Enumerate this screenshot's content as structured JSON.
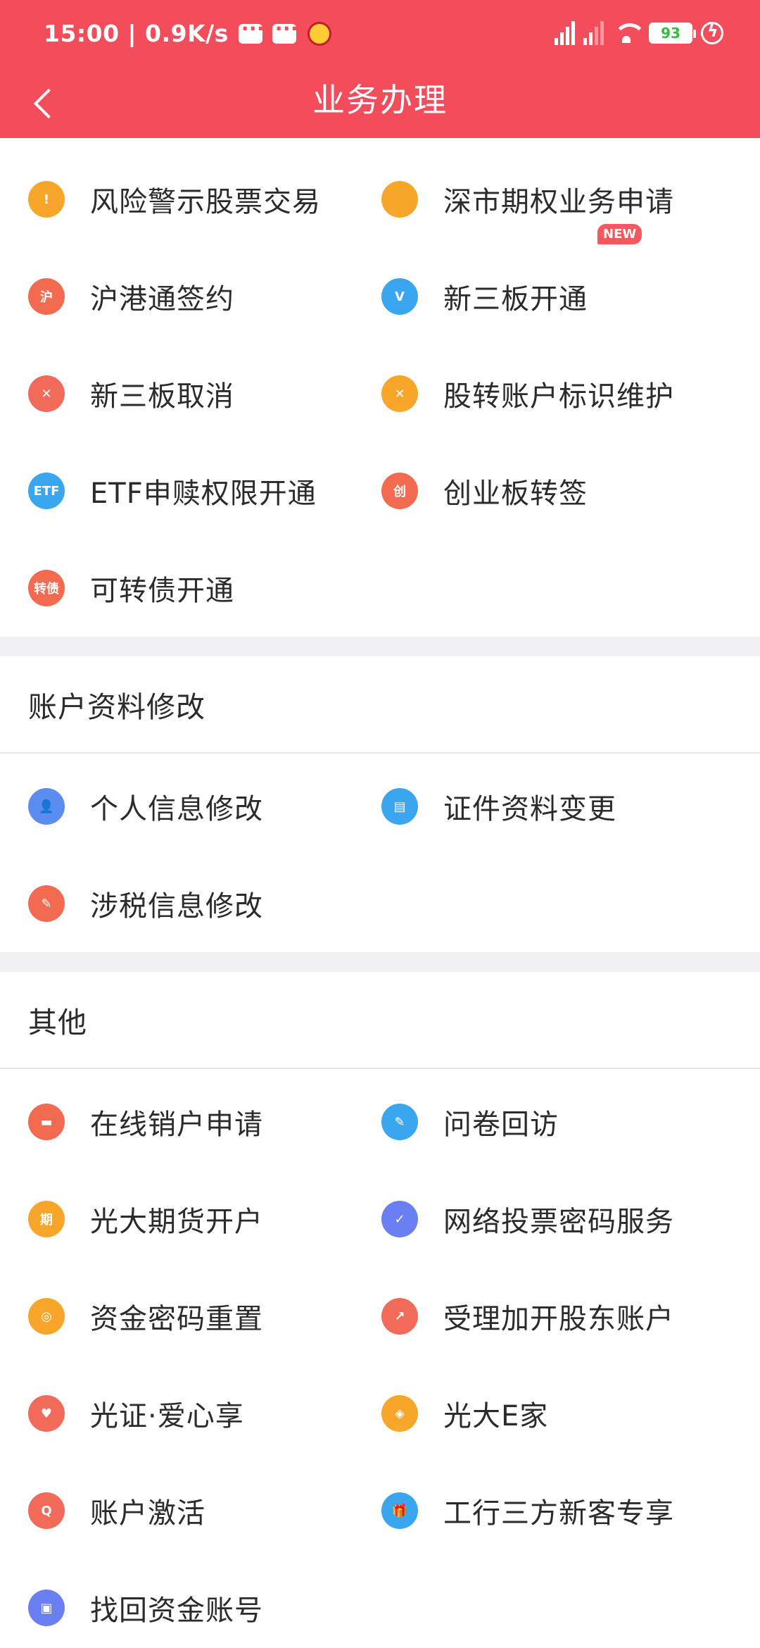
{
  "status_bar": {
    "time_speed": "15:00 | 0.9K/s",
    "battery": "93"
  },
  "header": {
    "title": "业务办理"
  },
  "colors": {
    "brand": "#f34c5a",
    "separator": "#f1f1f3"
  },
  "sections": [
    {
      "title": "",
      "items": [
        {
          "label": "风险警示股票交易",
          "icon": "shield-icon",
          "color": "#f7a52b",
          "glyph": "!"
        },
        {
          "label": "深市期权业务申请",
          "icon": "briefcase-icon",
          "color": "#f7a52b",
          "glyph": ""
        },
        {
          "label": "沪港通签约",
          "icon": "sign-icon",
          "color": "#f26a4f",
          "glyph": "沪"
        },
        {
          "label": "新三板开通",
          "icon": "v-icon",
          "color": "#3aa6f0",
          "glyph": "V",
          "badge": "NEW"
        },
        {
          "label": "新三板取消",
          "icon": "cancel-icon",
          "color": "#f26a5a",
          "glyph": "✕"
        },
        {
          "label": "股转账户标识维护",
          "icon": "tools-icon",
          "color": "#f7a52b",
          "glyph": "✕"
        },
        {
          "label": "ETF申赎权限开通",
          "icon": "etf-icon",
          "color": "#3aa6f0",
          "glyph": "ETF"
        },
        {
          "label": "创业板转签",
          "icon": "gem-card-icon",
          "color": "#f26a4f",
          "glyph": "创"
        },
        {
          "label": "可转债开通",
          "icon": "convertible-bond-icon",
          "color": "#f26a4f",
          "glyph": "转债"
        }
      ]
    },
    {
      "title": "账户资料修改",
      "items": [
        {
          "label": "个人信息修改",
          "icon": "user-edit-icon",
          "color": "#5b8df0",
          "glyph": "👤"
        },
        {
          "label": "证件资料变更",
          "icon": "id-card-icon",
          "color": "#3aa6f0",
          "glyph": "▤"
        },
        {
          "label": "涉税信息修改",
          "icon": "pencil-icon",
          "color": "#f26a4f",
          "glyph": "✎"
        }
      ]
    },
    {
      "title": "其他",
      "items": [
        {
          "label": "在线销户申请",
          "icon": "card-cancel-icon",
          "color": "#f26a4f",
          "glyph": "▬"
        },
        {
          "label": "问卷回访",
          "icon": "questionnaire-icon",
          "color": "#3aa6f0",
          "glyph": "✎"
        },
        {
          "label": "光大期货开户",
          "icon": "futures-icon",
          "color": "#f7a52b",
          "glyph": "期"
        },
        {
          "label": "网络投票密码服务",
          "icon": "vote-check-icon",
          "color": "#6a7ff2",
          "glyph": "✓"
        },
        {
          "label": "资金密码重置",
          "icon": "coin-icon",
          "color": "#f7a52b",
          "glyph": "◎"
        },
        {
          "label": "受理加开股东账户",
          "icon": "trend-icon",
          "color": "#f26a5a",
          "glyph": "↗"
        },
        {
          "label": "光证·爱心享",
          "icon": "heart-icon",
          "color": "#f26a5a",
          "glyph": "♥"
        },
        {
          "label": "光大E家",
          "icon": "handshake-icon",
          "color": "#f7a52b",
          "glyph": "◈"
        },
        {
          "label": "账户激活",
          "icon": "activate-icon",
          "color": "#f26a5a",
          "glyph": "Q"
        },
        {
          "label": "工行三方新客专享",
          "icon": "gift-icon",
          "color": "#3aa6f0",
          "glyph": "🎁"
        },
        {
          "label": "找回资金账号",
          "icon": "account-find-icon",
          "color": "#6a7ff2",
          "glyph": "▣"
        }
      ]
    }
  ]
}
